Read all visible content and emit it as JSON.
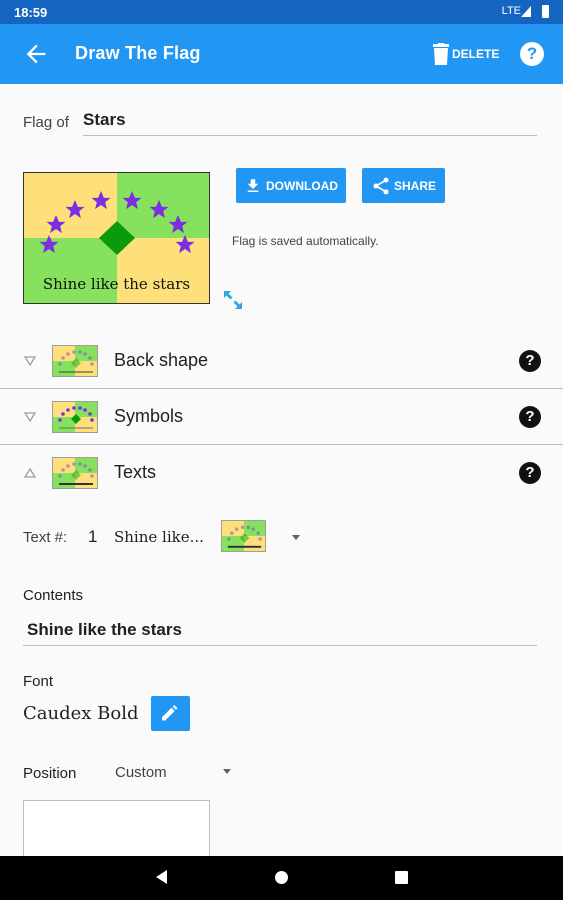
{
  "status_bar": {
    "time": "18:59",
    "network": "LTE"
  },
  "app_bar": {
    "title": "Draw The Flag",
    "delete_label": "DELETE",
    "help_symbol": "?"
  },
  "flag_of": {
    "label": "Flag of",
    "value": "Stars"
  },
  "flag_preview": {
    "caption": "Shine like the stars",
    "colors": {
      "yellow": "#fde07a",
      "green": "#86e15e",
      "diamond": "#0a9a0a",
      "stars": "#7b2fe0"
    }
  },
  "actions": {
    "download_label": "DOWNLOAD",
    "share_label": "SHARE",
    "autosave_note": "Flag is saved automatically."
  },
  "sections": [
    {
      "name": "Back shape",
      "expanded": false,
      "help_symbol": "?"
    },
    {
      "name": "Symbols",
      "expanded": false,
      "help_symbol": "?"
    },
    {
      "name": "Texts",
      "expanded": true,
      "help_symbol": "?"
    }
  ],
  "text_editor": {
    "text_num_label": "Text #:",
    "text_num_value": "1",
    "text_selected": "Shine like...",
    "contents_label": "Contents",
    "contents_value": "Shine like the stars",
    "font_label": "Font",
    "font_value": "Caudex Bold",
    "position_label": "Position",
    "position_value": "Custom"
  },
  "icons": {
    "back": "arrow-left-icon",
    "delete": "trash-icon",
    "help": "help-circle-icon",
    "download": "download-icon",
    "share": "share-icon",
    "expand": "expand-arrows-icon",
    "edit": "pencil-icon"
  },
  "accent_color": "#2196f3"
}
